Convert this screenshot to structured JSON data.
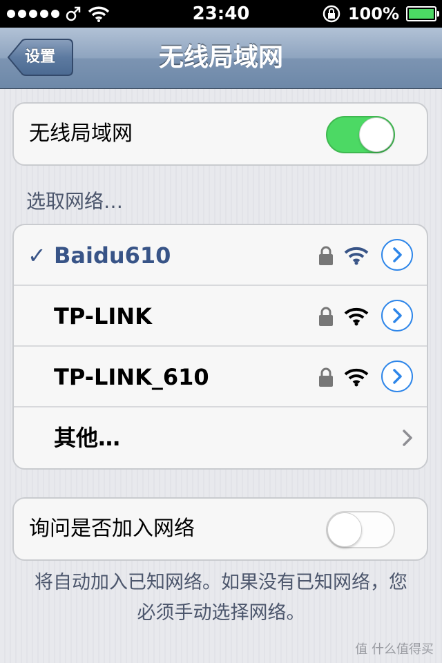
{
  "status_bar": {
    "time": "23:40",
    "battery_percent": "100%",
    "signal_bars_filled": 5
  },
  "nav": {
    "title": "无线局域网",
    "back_label": "设置"
  },
  "wifi_toggle": {
    "label": "无线局域网",
    "on": true
  },
  "networks_header": "选取网络…",
  "networks": [
    {
      "name": "Baidu610",
      "selected": true,
      "check": "✓",
      "locked": true
    },
    {
      "name": "TP-LINK",
      "selected": false,
      "locked": true
    },
    {
      "name": "TP-LINK_610",
      "selected": false,
      "locked": true
    }
  ],
  "other_label": "其他…",
  "ask_toggle": {
    "label": "询问是否加入网络",
    "on": false
  },
  "footer_text": "将自动加入已知网络。如果没有已知网络，您必须手动选择网络。",
  "watermark": "值 什么值得买",
  "colors": {
    "accent": "#2e86e9",
    "selected_text": "#385487",
    "switch_on": "#4cd964"
  }
}
